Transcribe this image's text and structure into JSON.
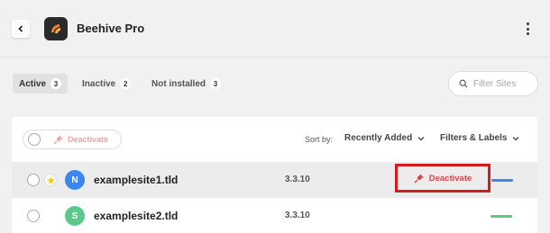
{
  "header": {
    "title": "Beehive Pro",
    "back_icon": "chevron-left-icon",
    "logo_icon": "beehive-logo-icon",
    "menu_icon": "vertical-ellipsis-icon"
  },
  "tabs": [
    {
      "label": "Active",
      "count": "3",
      "active": true
    },
    {
      "label": "Inactive",
      "count": "2",
      "active": false
    },
    {
      "label": "Not installed",
      "count": "3",
      "active": false
    }
  ],
  "search": {
    "placeholder": "Filter Sites",
    "value": ""
  },
  "toolbar": {
    "bulk_action": "Deactivate",
    "sort_label": "Sort by:",
    "sort_value": "Recently Added",
    "filters_label": "Filters & Labels"
  },
  "rows": [
    {
      "initial": "N",
      "name": "examplesite1.tld",
      "version": "3.3.10",
      "action": "Deactivate",
      "avatar_color": "#3d86f0",
      "status_color": "#3d86f0",
      "starred": true
    },
    {
      "initial": "S",
      "name": "examplesite2.tld",
      "version": "3.3.10",
      "avatar_color": "#5cc98a",
      "status_color": "#5cc98a",
      "starred": false
    }
  ],
  "colors": {
    "accent_red": "#d41a1a",
    "star": "#f5c518"
  }
}
